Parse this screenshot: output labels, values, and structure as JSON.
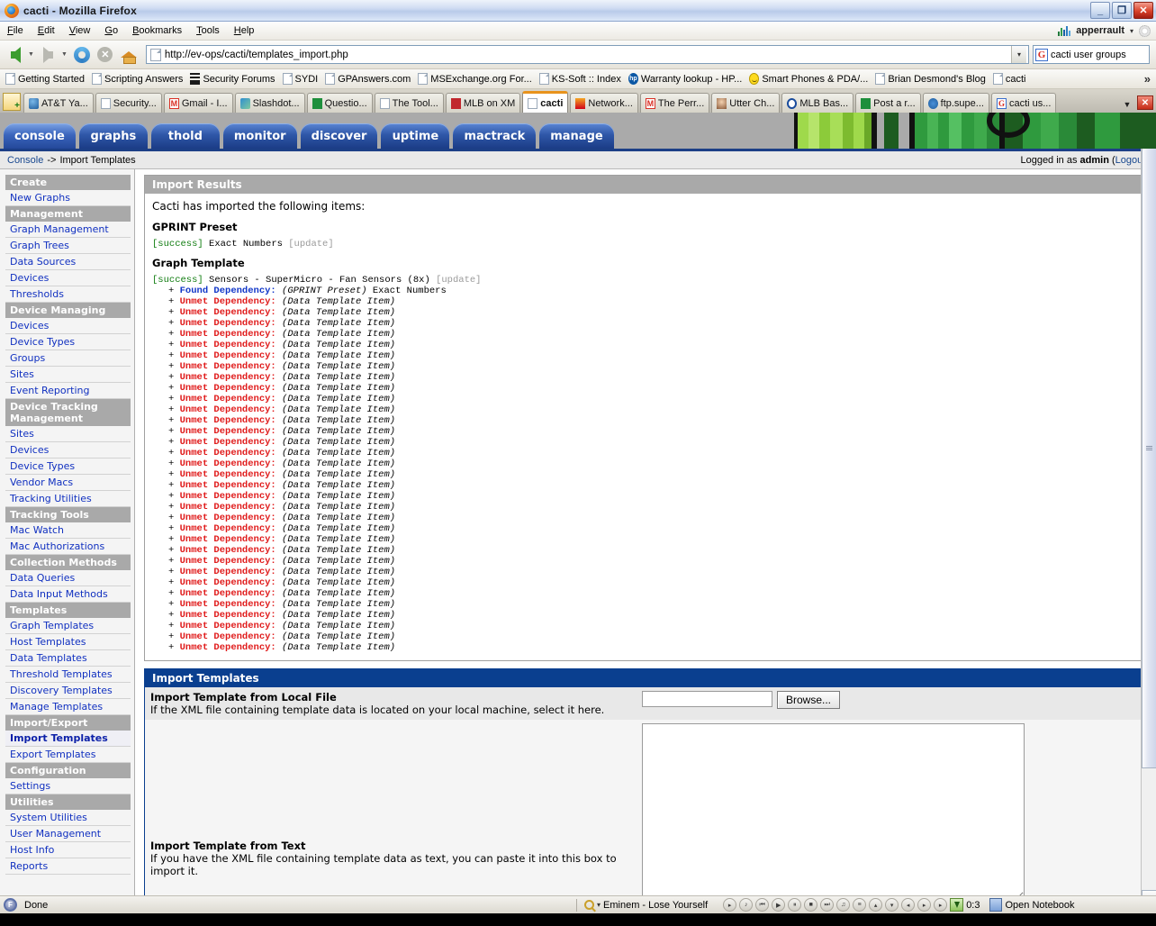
{
  "window": {
    "title": "cacti - Mozilla Firefox",
    "minimize": "_",
    "restore": "❐",
    "close": "✕"
  },
  "menubar": {
    "items": [
      "File",
      "Edit",
      "View",
      "Go",
      "Bookmarks",
      "Tools",
      "Help"
    ],
    "user": "apperrault",
    "caret": "▾"
  },
  "navbar": {
    "url": "http://ev-ops/cacti/templates_import.php",
    "search_value": "cacti user groups",
    "url_dropdown_caret": "▾",
    "stop_glyph": "✕",
    "google_letter": "G"
  },
  "bookmarks": {
    "items": [
      {
        "label": "Getting Started",
        "icon": "doc"
      },
      {
        "label": "Scripting Answers",
        "icon": "doc"
      },
      {
        "label": "Security Forums",
        "icon": "bars"
      },
      {
        "label": "SYDI",
        "icon": "doc"
      },
      {
        "label": "GPAnswers.com",
        "icon": "doc"
      },
      {
        "label": "MSExchange.org For...",
        "icon": "doc"
      },
      {
        "label": "KS-Soft :: Index",
        "icon": "doc"
      },
      {
        "label": "Warranty lookup - HP...",
        "icon": "hp"
      },
      {
        "label": "Smart Phones & PDA/...",
        "icon": "smiley"
      },
      {
        "label": "Brian Desmond's Blog",
        "icon": "doc"
      },
      {
        "label": "cacti",
        "icon": "doc"
      }
    ],
    "overflow": "»"
  },
  "tabs": {
    "items": [
      {
        "label": "AT&T Ya...",
        "icon": "att",
        "active": false
      },
      {
        "label": "Security...",
        "icon": "doc",
        "active": false
      },
      {
        "label": "Gmail - I...",
        "icon": "gm",
        "active": false
      },
      {
        "label": "Slashdot...",
        "icon": "slash",
        "active": false
      },
      {
        "label": "Questio...",
        "icon": "green",
        "active": false
      },
      {
        "label": "The Tool...",
        "icon": "doc",
        "active": false
      },
      {
        "label": "MLB on XM",
        "icon": "mlbx",
        "active": false
      },
      {
        "label": "cacti",
        "icon": "doc",
        "active": true
      },
      {
        "label": "Network...",
        "icon": "net",
        "active": false
      },
      {
        "label": "The Perr...",
        "icon": "gm",
        "active": false
      },
      {
        "label": "Utter Ch...",
        "icon": "face",
        "active": false
      },
      {
        "label": "MLB Bas...",
        "icon": "mlbb",
        "active": false
      },
      {
        "label": "Post a r...",
        "icon": "green",
        "active": false
      },
      {
        "label": "ftp.supe...",
        "icon": "ftp",
        "active": false
      },
      {
        "label": "cacti us...",
        "icon": "gbox",
        "active": false
      }
    ],
    "list_caret": "▼",
    "close_glyph": "✕"
  },
  "cacti_tabs": [
    {
      "label": "console",
      "active": true
    },
    {
      "label": "graphs",
      "active": false
    },
    {
      "label": "thold",
      "active": false
    },
    {
      "label": "monitor",
      "active": false
    },
    {
      "label": "discover",
      "active": false
    },
    {
      "label": "uptime",
      "active": false
    },
    {
      "label": "mactrack",
      "active": false
    },
    {
      "label": "manage",
      "active": false
    }
  ],
  "breadcrumb": {
    "root": "Console",
    "separator": "->",
    "current": "Import Templates",
    "logged_in_prefix": "Logged in as ",
    "logged_in_user": "admin",
    "logout_open": " (",
    "logout": "Logout",
    "logout_close": ")"
  },
  "sidebar": {
    "groups": [
      {
        "head": "Create",
        "links": [
          {
            "label": "New Graphs",
            "selected": false
          }
        ]
      },
      {
        "head": "Management",
        "links": [
          {
            "label": "Graph Management",
            "selected": false
          },
          {
            "label": "Graph Trees",
            "selected": false
          },
          {
            "label": "Data Sources",
            "selected": false
          },
          {
            "label": "Devices",
            "selected": false
          },
          {
            "label": "Thresholds",
            "selected": false
          }
        ]
      },
      {
        "head": "Device Managing",
        "links": [
          {
            "label": "Devices",
            "selected": false
          },
          {
            "label": "Device Types",
            "selected": false
          },
          {
            "label": "Groups",
            "selected": false
          },
          {
            "label": "Sites",
            "selected": false
          },
          {
            "label": "Event Reporting",
            "selected": false
          }
        ]
      },
      {
        "head": "Device Tracking Management",
        "links": [
          {
            "label": "Sites",
            "selected": false
          },
          {
            "label": "Devices",
            "selected": false
          },
          {
            "label": "Device Types",
            "selected": false
          },
          {
            "label": "Vendor Macs",
            "selected": false
          },
          {
            "label": "Tracking Utilities",
            "selected": false
          }
        ]
      },
      {
        "head": "Tracking Tools",
        "links": [
          {
            "label": "Mac Watch",
            "selected": false
          },
          {
            "label": "Mac Authorizations",
            "selected": false
          }
        ]
      },
      {
        "head": "Collection Methods",
        "links": [
          {
            "label": "Data Queries",
            "selected": false
          },
          {
            "label": "Data Input Methods",
            "selected": false
          }
        ]
      },
      {
        "head": "Templates",
        "links": [
          {
            "label": "Graph Templates",
            "selected": false
          },
          {
            "label": "Host Templates",
            "selected": false
          },
          {
            "label": "Data Templates",
            "selected": false
          },
          {
            "label": "Threshold Templates",
            "selected": false
          },
          {
            "label": "Discovery Templates",
            "selected": false
          },
          {
            "label": "Manage Templates",
            "selected": false
          }
        ]
      },
      {
        "head": "Import/Export",
        "links": [
          {
            "label": "Import Templates",
            "selected": true
          },
          {
            "label": "Export Templates",
            "selected": false
          }
        ]
      },
      {
        "head": "Configuration",
        "links": [
          {
            "label": "Settings",
            "selected": false
          }
        ]
      },
      {
        "head": "Utilities",
        "links": [
          {
            "label": "System Utilities",
            "selected": false
          },
          {
            "label": "User Management",
            "selected": false
          },
          {
            "label": "Host Info",
            "selected": false
          },
          {
            "label": "Reports",
            "selected": false
          }
        ]
      }
    ]
  },
  "import_results": {
    "panel_title": "Import Results",
    "intro": "Cacti has imported the following items:",
    "sections": [
      {
        "heading": "GPRINT Preset",
        "entries": [
          {
            "status": "[success]",
            "name": "Exact Numbers",
            "action": "[update]",
            "deps": []
          }
        ]
      },
      {
        "heading": "Graph Template",
        "entries": [
          {
            "status": "[success]",
            "name": "Sensors - SuperMicro - Fan Sensors (8x)",
            "action": "[update]",
            "deps": [
              {
                "plus": "+",
                "kind": "Found Dependency:",
                "type": "found",
                "object": "(GPRINT Preset)",
                "extra": " Exact Numbers"
              },
              {
                "plus": "+",
                "kind": "Unmet Dependency:",
                "type": "unmet",
                "object": "(Data Template Item)",
                "extra": ""
              },
              {
                "plus": "+",
                "kind": "Unmet Dependency:",
                "type": "unmet",
                "object": "(Data Template Item)",
                "extra": ""
              },
              {
                "plus": "+",
                "kind": "Unmet Dependency:",
                "type": "unmet",
                "object": "(Data Template Item)",
                "extra": ""
              },
              {
                "plus": "+",
                "kind": "Unmet Dependency:",
                "type": "unmet",
                "object": "(Data Template Item)",
                "extra": ""
              },
              {
                "plus": "+",
                "kind": "Unmet Dependency:",
                "type": "unmet",
                "object": "(Data Template Item)",
                "extra": ""
              },
              {
                "plus": "+",
                "kind": "Unmet Dependency:",
                "type": "unmet",
                "object": "(Data Template Item)",
                "extra": ""
              },
              {
                "plus": "+",
                "kind": "Unmet Dependency:",
                "type": "unmet",
                "object": "(Data Template Item)",
                "extra": ""
              },
              {
                "plus": "+",
                "kind": "Unmet Dependency:",
                "type": "unmet",
                "object": "(Data Template Item)",
                "extra": ""
              },
              {
                "plus": "+",
                "kind": "Unmet Dependency:",
                "type": "unmet",
                "object": "(Data Template Item)",
                "extra": ""
              },
              {
                "plus": "+",
                "kind": "Unmet Dependency:",
                "type": "unmet",
                "object": "(Data Template Item)",
                "extra": ""
              },
              {
                "plus": "+",
                "kind": "Unmet Dependency:",
                "type": "unmet",
                "object": "(Data Template Item)",
                "extra": ""
              },
              {
                "plus": "+",
                "kind": "Unmet Dependency:",
                "type": "unmet",
                "object": "(Data Template Item)",
                "extra": ""
              },
              {
                "plus": "+",
                "kind": "Unmet Dependency:",
                "type": "unmet",
                "object": "(Data Template Item)",
                "extra": ""
              },
              {
                "plus": "+",
                "kind": "Unmet Dependency:",
                "type": "unmet",
                "object": "(Data Template Item)",
                "extra": ""
              },
              {
                "plus": "+",
                "kind": "Unmet Dependency:",
                "type": "unmet",
                "object": "(Data Template Item)",
                "extra": ""
              },
              {
                "plus": "+",
                "kind": "Unmet Dependency:",
                "type": "unmet",
                "object": "(Data Template Item)",
                "extra": ""
              },
              {
                "plus": "+",
                "kind": "Unmet Dependency:",
                "type": "unmet",
                "object": "(Data Template Item)",
                "extra": ""
              },
              {
                "plus": "+",
                "kind": "Unmet Dependency:",
                "type": "unmet",
                "object": "(Data Template Item)",
                "extra": ""
              },
              {
                "plus": "+",
                "kind": "Unmet Dependency:",
                "type": "unmet",
                "object": "(Data Template Item)",
                "extra": ""
              },
              {
                "plus": "+",
                "kind": "Unmet Dependency:",
                "type": "unmet",
                "object": "(Data Template Item)",
                "extra": ""
              },
              {
                "plus": "+",
                "kind": "Unmet Dependency:",
                "type": "unmet",
                "object": "(Data Template Item)",
                "extra": ""
              },
              {
                "plus": "+",
                "kind": "Unmet Dependency:",
                "type": "unmet",
                "object": "(Data Template Item)",
                "extra": ""
              },
              {
                "plus": "+",
                "kind": "Unmet Dependency:",
                "type": "unmet",
                "object": "(Data Template Item)",
                "extra": ""
              },
              {
                "plus": "+",
                "kind": "Unmet Dependency:",
                "type": "unmet",
                "object": "(Data Template Item)",
                "extra": ""
              },
              {
                "plus": "+",
                "kind": "Unmet Dependency:",
                "type": "unmet",
                "object": "(Data Template Item)",
                "extra": ""
              },
              {
                "plus": "+",
                "kind": "Unmet Dependency:",
                "type": "unmet",
                "object": "(Data Template Item)",
                "extra": ""
              },
              {
                "plus": "+",
                "kind": "Unmet Dependency:",
                "type": "unmet",
                "object": "(Data Template Item)",
                "extra": ""
              },
              {
                "plus": "+",
                "kind": "Unmet Dependency:",
                "type": "unmet",
                "object": "(Data Template Item)",
                "extra": ""
              },
              {
                "plus": "+",
                "kind": "Unmet Dependency:",
                "type": "unmet",
                "object": "(Data Template Item)",
                "extra": ""
              },
              {
                "plus": "+",
                "kind": "Unmet Dependency:",
                "type": "unmet",
                "object": "(Data Template Item)",
                "extra": ""
              },
              {
                "plus": "+",
                "kind": "Unmet Dependency:",
                "type": "unmet",
                "object": "(Data Template Item)",
                "extra": ""
              },
              {
                "plus": "+",
                "kind": "Unmet Dependency:",
                "type": "unmet",
                "object": "(Data Template Item)",
                "extra": ""
              },
              {
                "plus": "+",
                "kind": "Unmet Dependency:",
                "type": "unmet",
                "object": "(Data Template Item)",
                "extra": ""
              }
            ]
          }
        ]
      }
    ]
  },
  "import_form": {
    "panel_title": "Import Templates",
    "local_file": {
      "label": "Import Template from Local File",
      "description": "If the XML file containing template data is located on your local machine, select it here.",
      "value": "",
      "browse_label": "Browse..."
    },
    "from_text": {
      "label": "Import Template from Text",
      "description": "If you have the XML file containing template data as text, you can paste it into this box to import it.",
      "value": ""
    }
  },
  "statusbar": {
    "text": "Done",
    "media_title": "Eminem - Lose Yourself",
    "time": "0:3",
    "notebook": "Open Notebook",
    "media_buttons": [
      "▸",
      "♪",
      "⏮",
      "▶",
      "⏸",
      "■",
      "⏭",
      "♫",
      "≡",
      "▴",
      "▾",
      "◂",
      "▸",
      "▸"
    ]
  },
  "colors": {
    "cacti_blue": "#0a3f8f",
    "nav_head_gray": "#a9a9a9",
    "link_blue": "#1030c0",
    "success_green": "#127d12",
    "unmet_red": "#e01b1b",
    "found_blue": "#1036c8"
  }
}
